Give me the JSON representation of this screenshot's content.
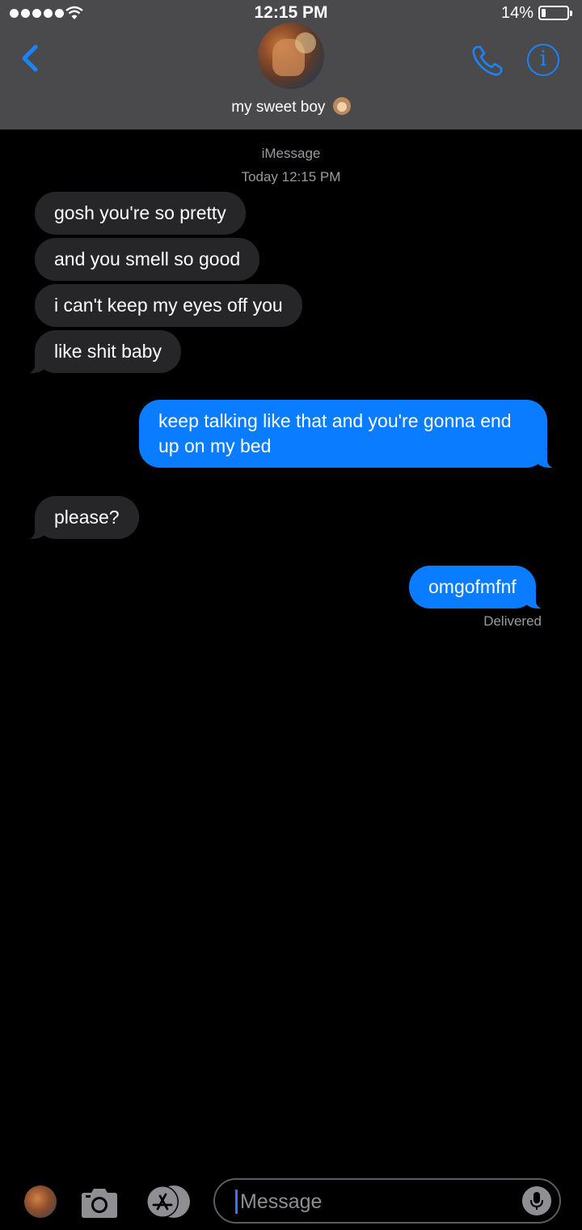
{
  "status_bar": {
    "time": "12:15 PM",
    "battery_percent": "14%",
    "signal_bars": 5,
    "icons": [
      "signal-dots-icon",
      "wifi-icon",
      "battery-icon"
    ]
  },
  "header": {
    "contact_name": "my sweet boy",
    "contact_emoji": "monkey-face-icon",
    "back_icon": "chevron-left-icon",
    "call_icon": "phone-icon",
    "info_icon": "info-icon",
    "info_glyph": "i",
    "accent_color": "#1a84ff"
  },
  "conversation": {
    "service": "iMessage",
    "timestamp": "Today 12:15 PM",
    "messages": [
      {
        "direction": "received",
        "text": "gosh you're so pretty"
      },
      {
        "direction": "received",
        "text": "and you smell so good"
      },
      {
        "direction": "received",
        "text": "i can't keep my eyes off you"
      },
      {
        "direction": "received",
        "text": "like shit baby"
      },
      {
        "direction": "sent",
        "text": "keep talking like that and you're gonna end up on my bed"
      },
      {
        "direction": "received",
        "text": "please?"
      },
      {
        "direction": "sent",
        "text": "omgofmfnf"
      }
    ],
    "delivery_status": "Delivered",
    "colors": {
      "sent_bubble": "#0a7cff",
      "received_bubble": "#262629"
    }
  },
  "input_bar": {
    "placeholder": "Message",
    "icons": [
      "animoji-avatar-icon",
      "camera-icon",
      "app-store-icon",
      "microphone-icon"
    ]
  }
}
